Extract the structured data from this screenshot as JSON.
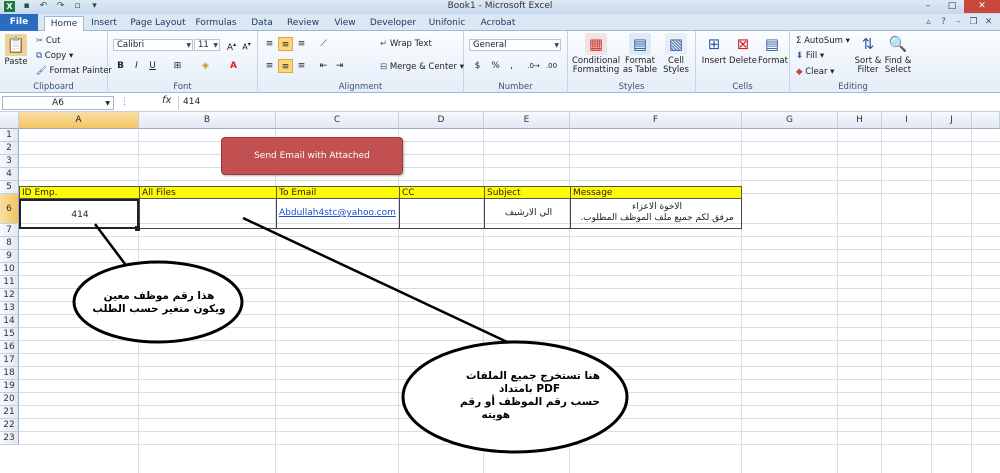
{
  "window": {
    "title": "Book1 - Microsoft Excel"
  },
  "tabs": [
    "File",
    "Home",
    "Insert",
    "Page Layout",
    "Formulas",
    "Data",
    "Review",
    "View",
    "Developer",
    "Unifonic",
    "Acrobat"
  ],
  "ribbon": {
    "clipboard": {
      "label": "Clipboard",
      "paste": "Paste",
      "cut": "Cut",
      "copy": "Copy",
      "format_painter": "Format Painter"
    },
    "font": {
      "label": "Font",
      "name": "Calibri",
      "size": "11"
    },
    "alignment": {
      "label": "Alignment",
      "wrap": "Wrap Text",
      "merge": "Merge & Center"
    },
    "number": {
      "label": "Number",
      "format": "General"
    },
    "styles": {
      "label": "Styles",
      "conditional": "Conditional Formatting",
      "format_table": "Format as Table",
      "cell_styles": "Cell Styles"
    },
    "cells": {
      "label": "Cells",
      "insert": "Insert",
      "delete": "Delete",
      "format": "Format"
    },
    "editing": {
      "label": "Editing",
      "autosum": "AutoSum",
      "fill": "Fill",
      "clear": "Clear",
      "sort": "Sort & Filter",
      "find": "Find & Select"
    }
  },
  "formula_bar": {
    "name_box": "A6",
    "fx": "fx",
    "value": "414"
  },
  "columns": [
    "A",
    "B",
    "C",
    "D",
    "E",
    "F",
    "G",
    "H",
    "I",
    "J"
  ],
  "rows": [
    "1",
    "2",
    "3",
    "4",
    "5",
    "6",
    "7",
    "8",
    "9",
    "10",
    "11",
    "12",
    "13",
    "14",
    "15",
    "16",
    "17",
    "18",
    "19",
    "20",
    "21",
    "22",
    "23"
  ],
  "table": {
    "headers": [
      "ID Emp.",
      "All Files",
      "To Email",
      "CC",
      "Subject",
      "Message"
    ],
    "row6": {
      "id": "414",
      "files": "",
      "email": "Abdullah4stc@yahoo.com",
      "cc": "",
      "subject": "الي الارشيف",
      "message_line1": "الاخوة الاعزاء",
      "message_line2": "مرفق لكم جميع ملف الموظف المطلوب."
    }
  },
  "button": {
    "label": "Send Email with Attached"
  },
  "callouts": {
    "left": [
      "هذا رقم موظف معين",
      "ويكون متغير حسب الطلب"
    ],
    "right": [
      "هنا تستخرج جميع الملفات",
      "PDF بامتداد",
      "حسب رقم الموظف أو رقم",
      "هويته"
    ]
  },
  "colors": {
    "header_fill": "#fffc01",
    "button_fill": "#c25050",
    "file_tab": "#2a6cc2"
  }
}
